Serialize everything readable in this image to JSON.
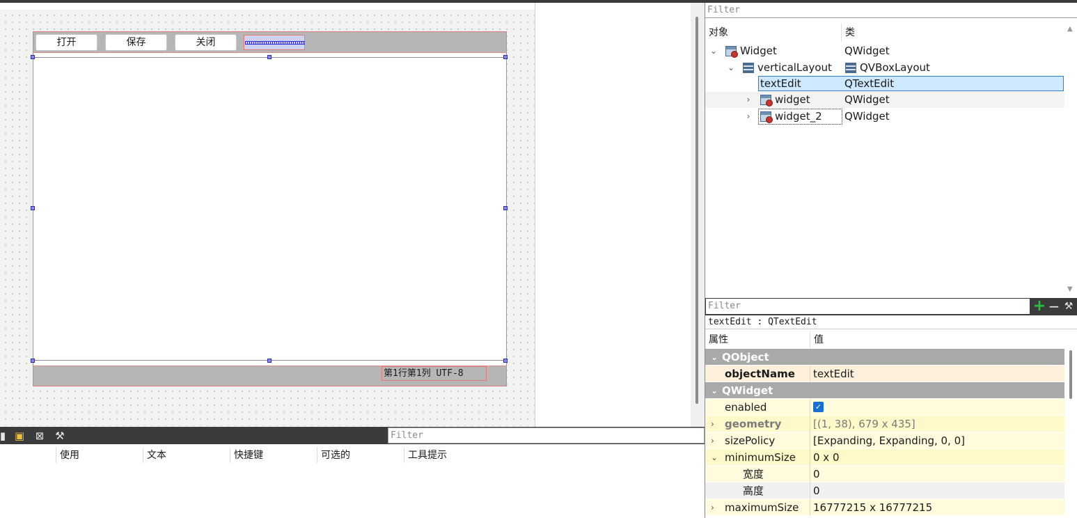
{
  "canvas": {
    "buttons": [
      "打开",
      "保存",
      "关闭"
    ],
    "status_label": "第1行第1列 UTF-8"
  },
  "action_editor": {
    "filter_placeholder": "Filter",
    "columns": [
      "使用",
      "文本",
      "快捷键",
      "可选的",
      "工具提示"
    ]
  },
  "object_inspector": {
    "filter_placeholder": "Filter",
    "headers": {
      "object": "对象",
      "class": "类"
    },
    "items": [
      {
        "name": "Widget",
        "class": "QWidget"
      },
      {
        "name": "verticalLayout",
        "class": "QVBoxLayout"
      },
      {
        "name": "textEdit",
        "class": "QTextEdit"
      },
      {
        "name": "widget",
        "class": "QWidget"
      },
      {
        "name": "widget_2",
        "class": "QWidget"
      }
    ]
  },
  "property_editor": {
    "filter_placeholder": "Filter",
    "title": "textEdit : QTextEdit",
    "headers": {
      "property": "属性",
      "value": "值"
    },
    "groups": {
      "qobject": "QObject",
      "qwidget": "QWidget"
    },
    "rows": {
      "objectName": {
        "name": "objectName",
        "value": "textEdit"
      },
      "enabled": {
        "name": "enabled",
        "checked": true
      },
      "geometry": {
        "name": "geometry",
        "value": "[(1, 38), 679 x 435]"
      },
      "sizePolicy": {
        "name": "sizePolicy",
        "value": "[Expanding, Expanding, 0, 0]"
      },
      "minimumSize": {
        "name": "minimumSize",
        "value": "0 x 0"
      },
      "width": {
        "name": "宽度",
        "value": "0"
      },
      "height": {
        "name": "高度",
        "value": "0"
      },
      "maximumSize": {
        "name": "maximumSize",
        "value": "16777215 x 16777215"
      }
    }
  },
  "colors": {
    "selection": "#cde8ff",
    "selection_border": "#2d7fd5",
    "group_bg": "#a9a9a9",
    "checkbox": "#1a6fd0"
  }
}
